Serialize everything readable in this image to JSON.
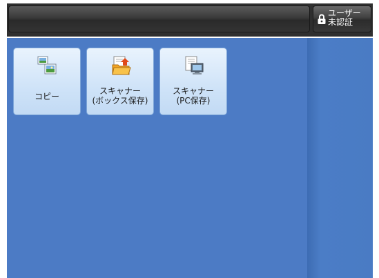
{
  "header": {
    "message": "",
    "login_button": {
      "label": "ユーザー\n未認証",
      "icon": "lock-icon"
    }
  },
  "apps": [
    {
      "label": "コピー",
      "icon": "copy-icon"
    },
    {
      "label": "スキャナー\n(ボックス保存)",
      "icon": "scan-to-folder-icon"
    },
    {
      "label": "スキャナー\n(PC保存)",
      "icon": "scan-to-pc-icon"
    }
  ],
  "colors": {
    "background": "#4c7bc5",
    "tile": "#d6e7f9",
    "topbar": "#2f2f2f"
  }
}
